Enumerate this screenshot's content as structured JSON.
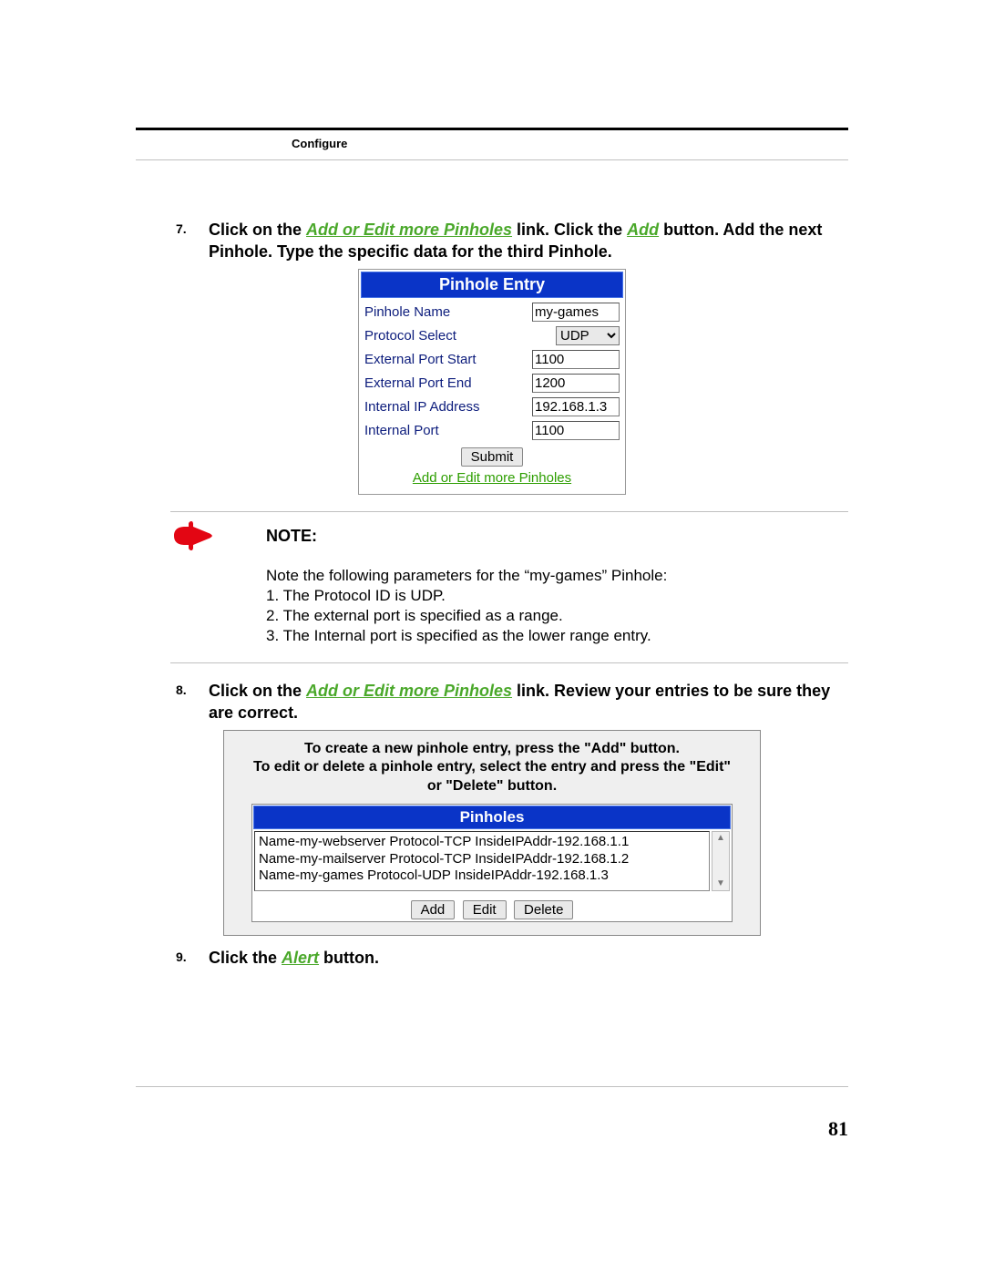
{
  "header": {
    "section": "Configure"
  },
  "steps": {
    "s7": {
      "num": "7.",
      "pre": "Click on the ",
      "link1": "Add or Edit more Pinholes",
      "mid": " link. Click the ",
      "link2": "Add",
      "post": " button. Add the next Pinhole. Type the specific data for the third Pinhole."
    },
    "s8": {
      "num": "8.",
      "pre": "Click on the ",
      "link1": "Add or Edit more Pinholes",
      "post": " link. Review your entries to be sure they are correct."
    },
    "s9": {
      "num": "9.",
      "pre": "Click the ",
      "link1": "Alert",
      "post": " button."
    }
  },
  "pinhole_entry": {
    "title": "Pinhole Entry",
    "labels": {
      "name": "Pinhole Name",
      "protocol": "Protocol Select",
      "ext_start": "External Port Start",
      "ext_end": "External Port End",
      "int_ip": "Internal IP Address",
      "int_port": "Internal Port"
    },
    "values": {
      "name": "my-games",
      "protocol": "UDP",
      "ext_start": "1100",
      "ext_end": "1200",
      "int_ip": "192.168.1.3",
      "int_port": "1100"
    },
    "submit": "Submit",
    "link": "Add or Edit more Pinholes"
  },
  "note": {
    "heading": "NOTE:",
    "intro": "Note the following parameters for the “my-games” Pinhole:",
    "items": [
      "1. The Protocol ID is UDP.",
      "2. The external port is specified as a range.",
      "3. The Internal port is specified as the lower range entry."
    ]
  },
  "pinholes_panel": {
    "instr": "To create a new pinhole entry, press the \"Add\" button.\nTo edit or delete a pinhole entry, select the entry and press the \"Edit\" or \"Delete\" button.",
    "title": "Pinholes",
    "items": [
      "Name-my-webserver Protocol-TCP InsideIPAddr-192.168.1.1",
      "Name-my-mailserver Protocol-TCP InsideIPAddr-192.168.1.2",
      "Name-my-games Protocol-UDP InsideIPAddr-192.168.1.3"
    ],
    "buttons": {
      "add": "Add",
      "edit": "Edit",
      "delete": "Delete"
    }
  },
  "page_number": "81"
}
